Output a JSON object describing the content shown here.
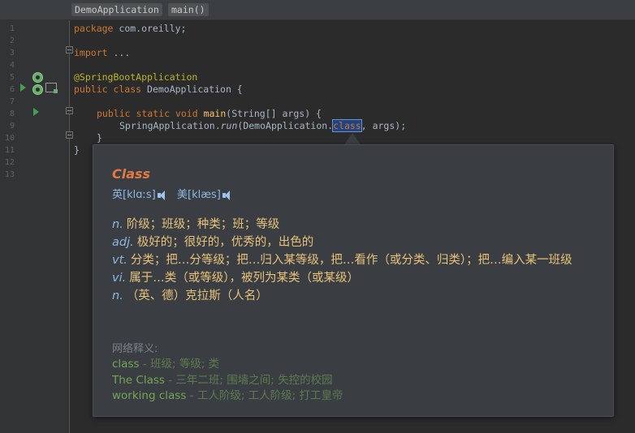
{
  "breadcrumbs": [
    "DemoApplication",
    "main()"
  ],
  "line_numbers": [
    "1",
    "2",
    "3",
    "4",
    "5",
    "6",
    "7",
    "8",
    "9",
    "10",
    "11",
    "12",
    "13"
  ],
  "code": {
    "l1": {
      "kw": "package",
      "rest": " com.oreilly;"
    },
    "l3": {
      "kw": "import",
      "rest": " ..."
    },
    "l5": {
      "ann": "@SpringBootApplication"
    },
    "l6": {
      "kw": "public class",
      "rest": " DemoApplication {"
    },
    "l8": {
      "kw": "public static void",
      "name": "main",
      "rest": "(String[] args) {"
    },
    "l9": {
      "cls": "SpringApplication.",
      "call": "run",
      "args": "(DemoApplication.",
      "selected": "class",
      "tail": ", args);"
    },
    "l10": "}",
    "l11": "}"
  },
  "popup": {
    "word": "Class",
    "uk_label": "英",
    "uk_ipa": "[klɑːs]",
    "us_label": "美",
    "us_ipa": "[klæs]",
    "definitions": [
      {
        "pos": "n.",
        "text": "阶级；班级；种类；班；等级"
      },
      {
        "pos": "adj.",
        "text": "极好的；很好的，优秀的，出色的"
      },
      {
        "pos": "vt.",
        "text": "分类；把…分等级；把…归入某等级，把…看作（或分类、归类）；把…编入某一班级"
      },
      {
        "pos": "vi.",
        "text": "属于…类（或等级），被列为某类（或某级）"
      },
      {
        "pos": "n.",
        "text": "（英、德）克拉斯（人名）"
      }
    ],
    "web_title": "网络释义:",
    "web": [
      {
        "term": "class",
        "meaning": "班级; 等级; 类"
      },
      {
        "term": "The Class",
        "meaning": "三年二班; 围墙之间; 失控的校园"
      },
      {
        "term": "working class",
        "meaning": "工人阶级; 工人阶级; 打工皇帝"
      }
    ]
  },
  "colors": {
    "background": "#2b2b2b",
    "keyword": "#cc7832",
    "annotation": "#bbb529",
    "method": "#ffc66d",
    "popup_word": "#e57a3f",
    "definition": "#e8c27a",
    "web_term": "#74a556"
  },
  "icons": [
    "spring-bean-icon",
    "run-gutter-icon",
    "fold-icon",
    "speaker-icon"
  ]
}
